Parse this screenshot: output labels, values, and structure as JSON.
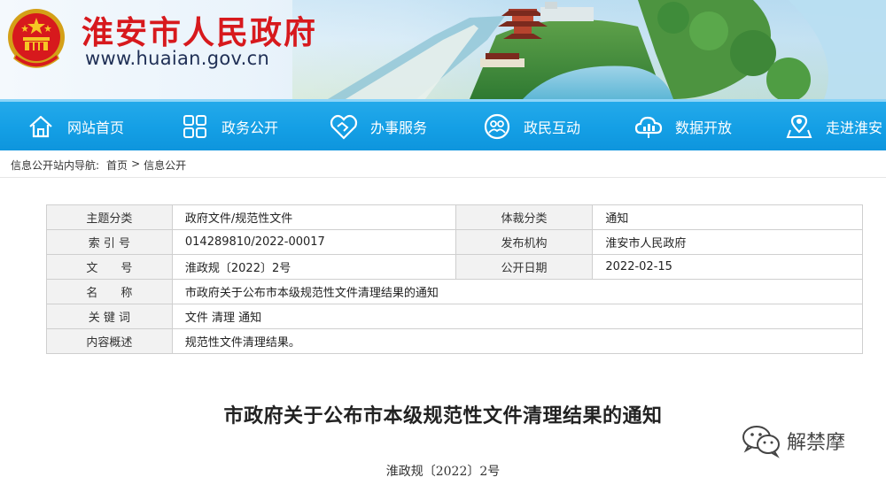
{
  "header": {
    "site_title": "淮安市人民政府",
    "site_domain": "www.huaian.gov.cn",
    "emblem_icon": "national-emblem-icon",
    "title_color": "#d7191d"
  },
  "nav": {
    "items": [
      {
        "label": "网站首页",
        "icon": "home-icon"
      },
      {
        "label": "政务公开",
        "icon": "grid-icon"
      },
      {
        "label": "办事服务",
        "icon": "handshake-icon"
      },
      {
        "label": "政民互动",
        "icon": "people-icon"
      },
      {
        "label": "数据开放",
        "icon": "cloud-data-icon"
      },
      {
        "label": "走进淮安",
        "icon": "map-pin-icon"
      }
    ],
    "color": "#149fe5"
  },
  "breadcrumb": {
    "prefix": "信息公开站内导航:",
    "items": [
      "首页",
      "信息公开"
    ],
    "separator": ">"
  },
  "info": {
    "rows": [
      {
        "label": "主题分类",
        "value": "政府文件/规范性文件",
        "label2": "体裁分类",
        "value2": "通知"
      },
      {
        "label": "索 引 号",
        "value": "014289810/2022-00017",
        "label2": "发布机构",
        "value2": "淮安市人民政府"
      },
      {
        "label": "文　　号",
        "value": "淮政规〔2022〕2号",
        "label2": "公开日期",
        "value2": "2022-02-15"
      },
      {
        "label": "名　　称",
        "value": "市政府关于公布市本级规范性文件清理结果的通知"
      },
      {
        "label": "关 键 词",
        "value": "文件 清理 通知"
      },
      {
        "label": "内容概述",
        "value": "规范性文件清理结果。"
      }
    ]
  },
  "article": {
    "title": "市政府关于公布市本级规范性文件清理结果的通知",
    "doc_number": "淮政规〔2022〕2号"
  },
  "watermark": {
    "text": "解禁摩",
    "icon": "wechat-icon"
  }
}
